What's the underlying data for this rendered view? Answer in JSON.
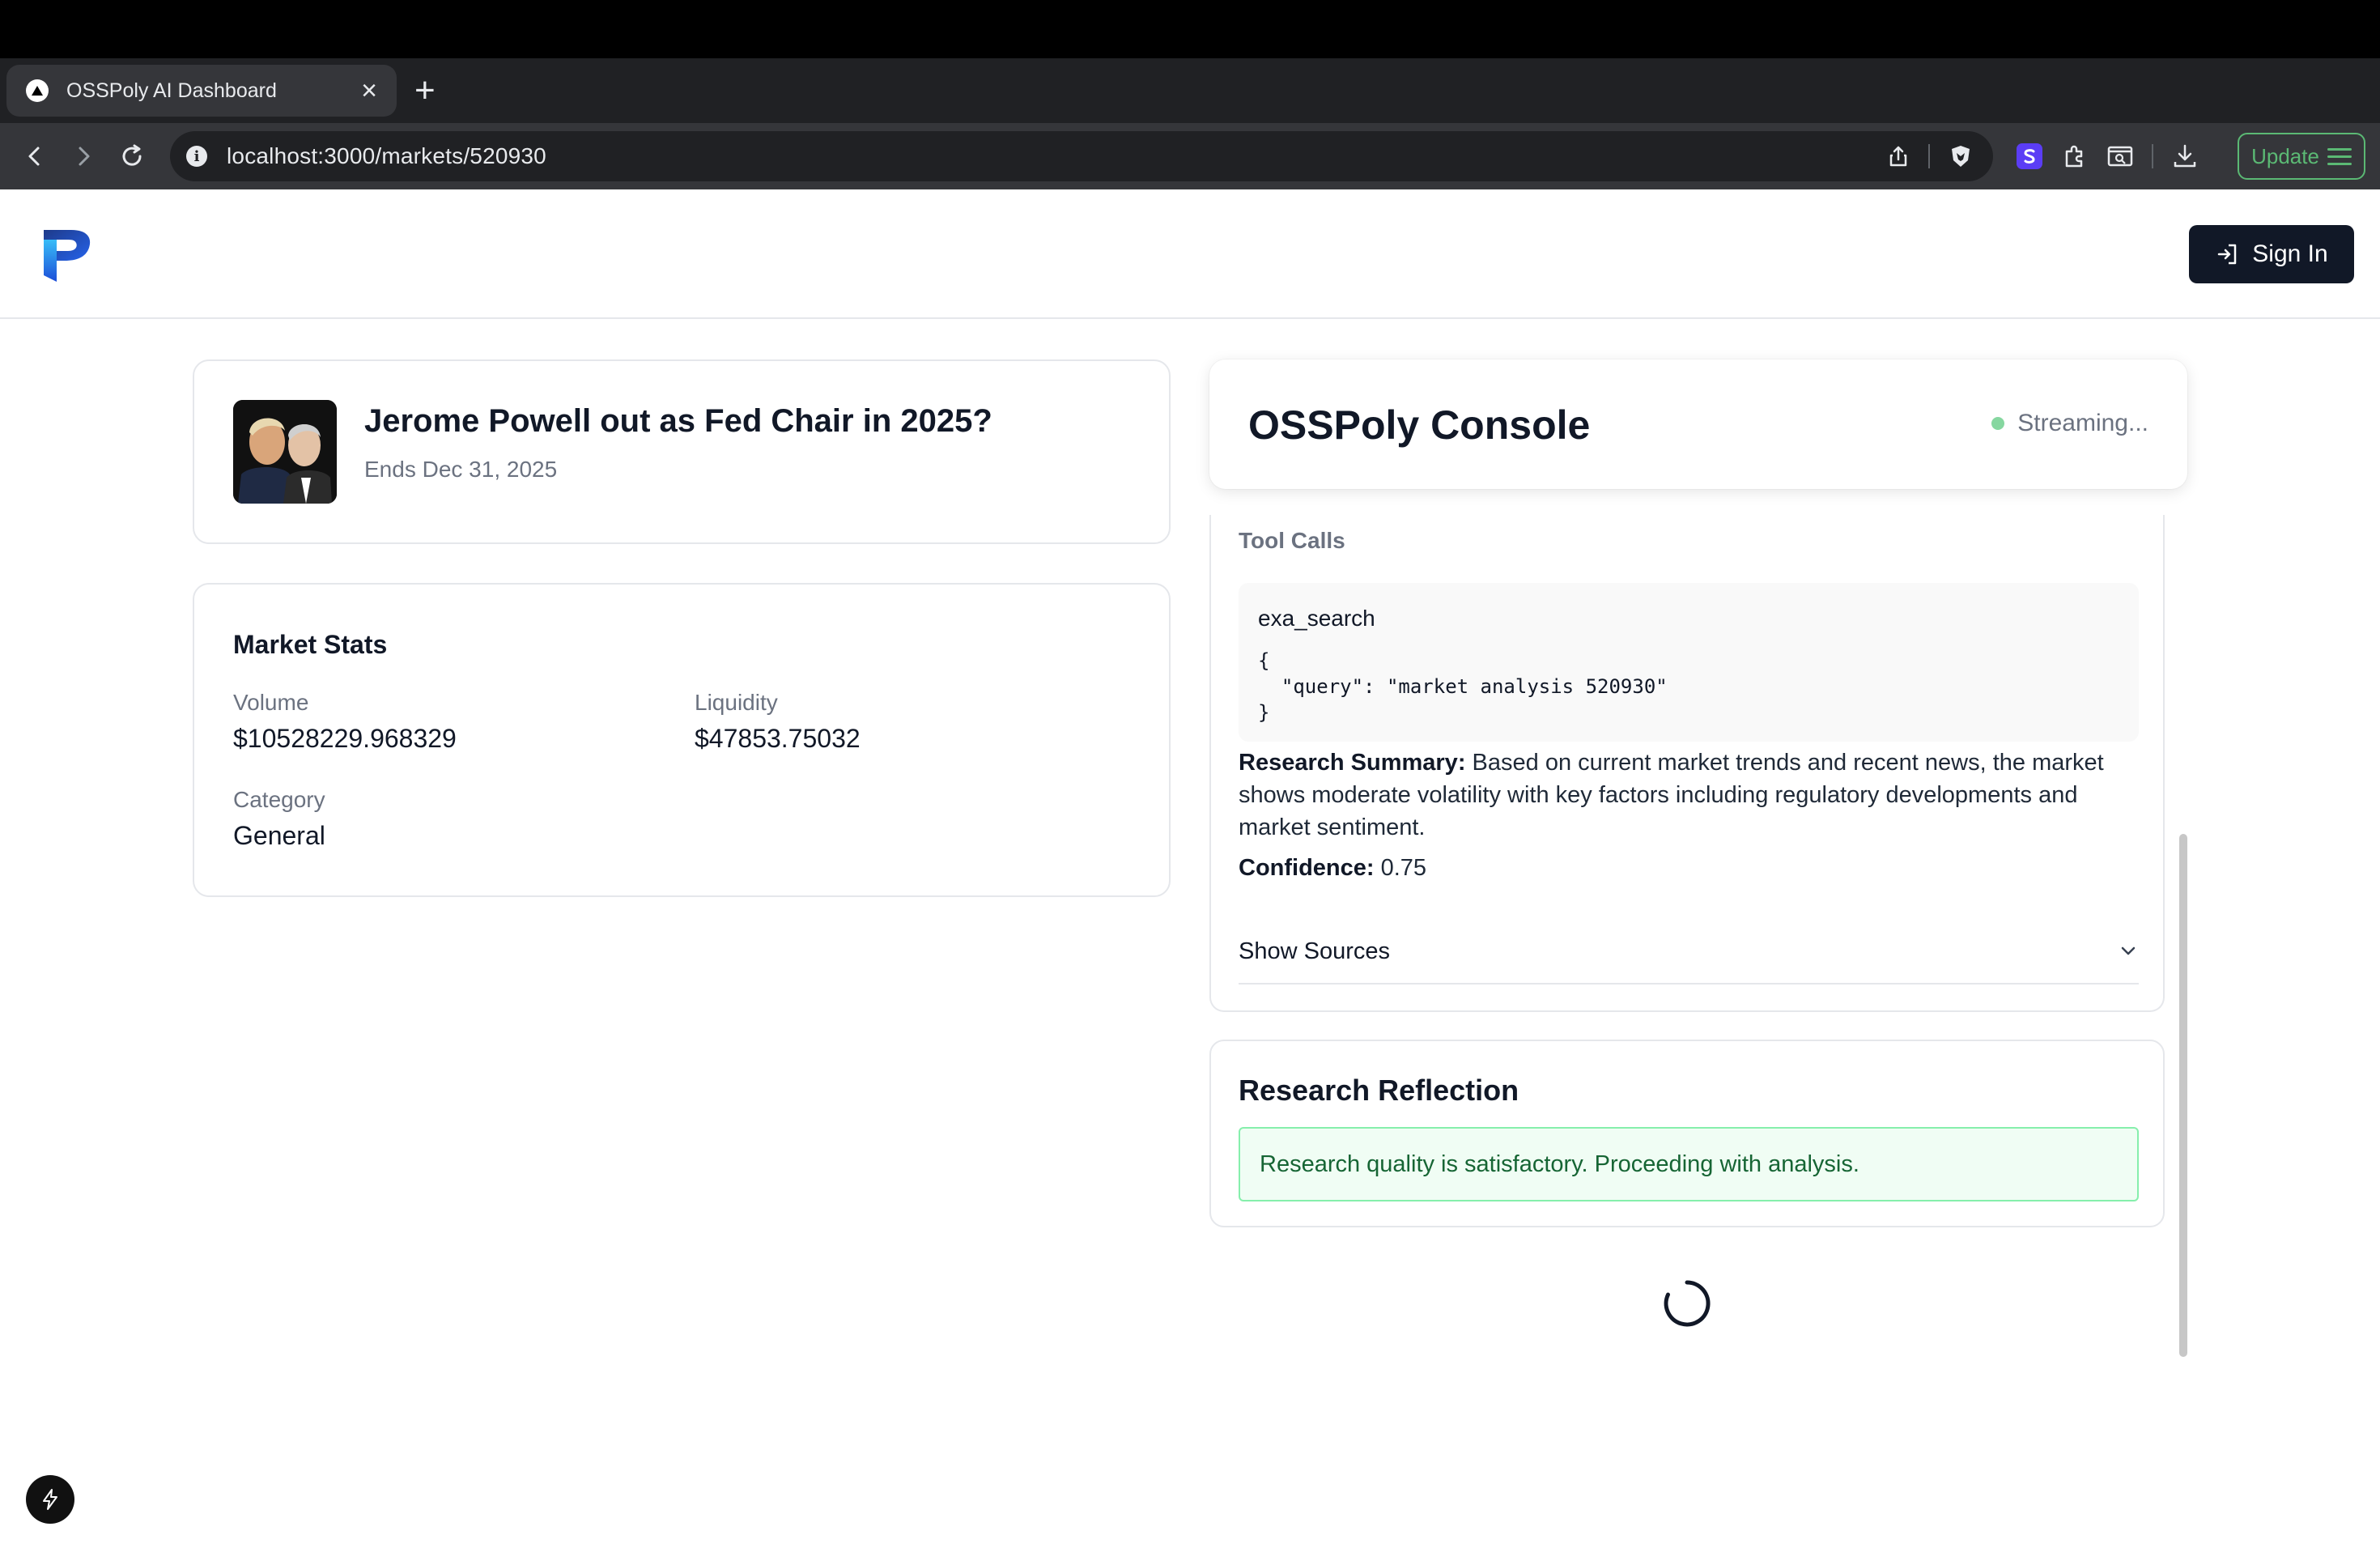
{
  "browser": {
    "tab_title": "OSSPoly AI Dashboard",
    "tab_close": "×",
    "new_tab": "+",
    "url": "localhost:3000/markets/520930",
    "update_label": "Update"
  },
  "header": {
    "sign_in_label": "Sign In"
  },
  "market": {
    "title": "Jerome Powell out as Fed Chair in 2025?",
    "ends": "Ends Dec 31, 2025"
  },
  "stats": {
    "title": "Market Stats",
    "volume_label": "Volume",
    "volume_value": "$10528229.968329",
    "liquidity_label": "Liquidity",
    "liquidity_value": "$47853.75032",
    "category_label": "Category",
    "category_value": "General"
  },
  "console": {
    "title": "OSSPoly Console",
    "status": "Streaming...",
    "status_color": "#86d7a0",
    "tool_calls_label": "Tool Calls",
    "tool_name": "exa_search",
    "tool_args": "{\n  \"query\": \"market analysis 520930\"\n}",
    "summary_label": "Research Summary:",
    "summary_text": " Based on current market trends and recent news, the market shows moderate volatility with key factors including regulatory developments and market sentiment.",
    "confidence_label": "Confidence:",
    "confidence_value": " 0.75",
    "sources_label": "Show Sources",
    "reflection_title": "Research Reflection",
    "reflection_text": "Research quality is satisfactory. Proceeding with analysis."
  }
}
